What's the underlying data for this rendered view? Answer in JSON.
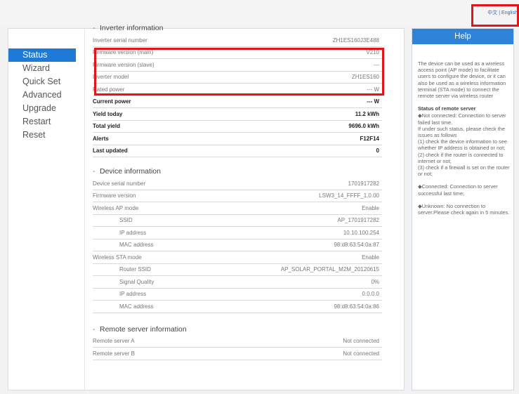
{
  "lang": {
    "zh": "中文",
    "sep": "|",
    "en": "English"
  },
  "menu": [
    {
      "label": "Status"
    },
    {
      "label": "Wizard"
    },
    {
      "label": "Quick Set"
    },
    {
      "label": "Advanced"
    },
    {
      "label": "Upgrade"
    },
    {
      "label": "Restart"
    },
    {
      "label": "Reset"
    }
  ],
  "inverter": {
    "title": "Inverter information",
    "rows": [
      {
        "label": "Inverter serial number",
        "value": "ZH1ES160J3E488"
      },
      {
        "label": "Firmware version (main)",
        "value": "V210"
      },
      {
        "label": "Firmware version (slave)",
        "value": "---"
      },
      {
        "label": "Inverter model",
        "value": "ZH1ES160"
      },
      {
        "label": "Rated power",
        "value": "--- W"
      },
      {
        "label": "Current power",
        "value": "--- W"
      },
      {
        "label": "Yield today",
        "value": "11.2 kWh"
      },
      {
        "label": "Total yield",
        "value": "9696.0 kWh"
      },
      {
        "label": "Alerts",
        "value": "F12F14"
      },
      {
        "label": "Last updated",
        "value": "0"
      }
    ]
  },
  "device": {
    "title": "Device information",
    "rows": [
      {
        "label": "Device serial number",
        "value": "1701917282"
      },
      {
        "label": "Firmware version",
        "value": "LSW3_14_FFFF_1.0.00"
      },
      {
        "label": "Wireless AP mode",
        "value": "Enable"
      },
      {
        "label": "SSID",
        "value": "AP_1701917282"
      },
      {
        "label": "IP address",
        "value": "10.10.100.254"
      },
      {
        "label": "MAC address",
        "value": "98:d8:63:54:0a:87"
      },
      {
        "label": "Wireless STA mode",
        "value": "Enable"
      },
      {
        "label": "Router SSID",
        "value": "AP_SOLAR_PORTAL_M2M_20120615"
      },
      {
        "label": "Signal Quality",
        "value": "0%"
      },
      {
        "label": "IP address",
        "value": "0.0.0.0"
      },
      {
        "label": "MAC address",
        "value": "98:d8:63:54:0a:86"
      }
    ]
  },
  "remote": {
    "title": "Remote server information",
    "rows": [
      {
        "label": "Remote server A",
        "value": "Not connected"
      },
      {
        "label": "Remote server B",
        "value": "Not connected"
      }
    ]
  },
  "help": {
    "title": "Help",
    "intro": "The device can be used as a wireless access point (AP mode) to facilitate users to configure the device, or it can also be used as a wireless information terminal (STA mode) to connect the remote server via wireless router",
    "status_title": "Status of remote server",
    "not_connected_1": "◆Not connected: Connection to server failed last time.",
    "not_connected_2": "If under such status, please check the issues as follows",
    "not_connected_3": "(1) check the device information to see whether IP address is obtained or not;",
    "not_connected_4": "(2) check if the router is connected to internet or not;",
    "not_connected_5": "(3) check if a firewall is set on the router or not;",
    "connected": "◆Connected: Connection to server successful last time;",
    "unknown": "◆Unknown: No connection to server.Please check again in 5 minutes."
  },
  "colors": {
    "accent": "#1e7ad6",
    "highlight_box": "#e1161d"
  }
}
